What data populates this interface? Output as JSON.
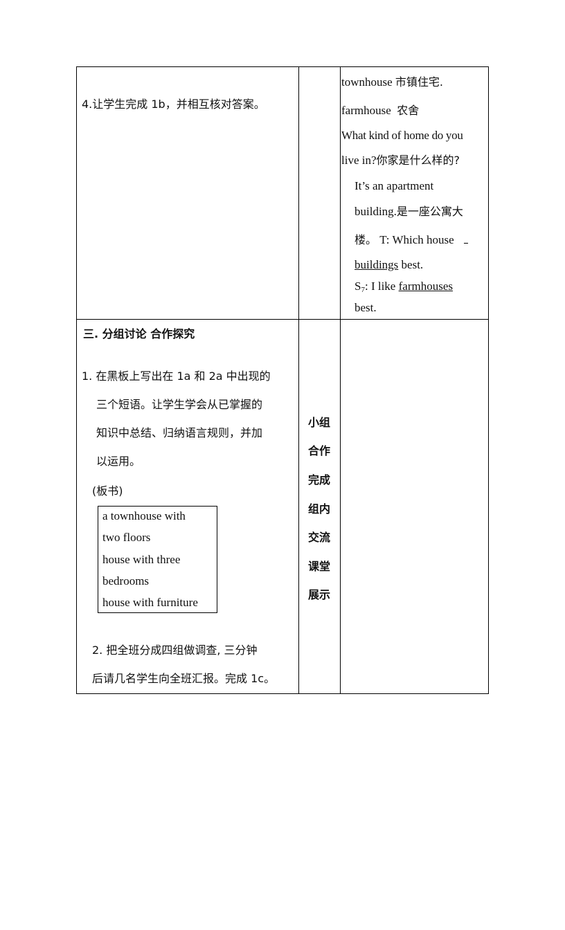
{
  "table": {
    "row1": {
      "left": "4.让学生完成 1b，并相互核对答案。",
      "middle": "",
      "right": {
        "line1_en": "townhouse",
        "line1_cn": "市镇住宅.",
        "line2_en": "farmhouse",
        "line2_cn": "农舍",
        "line3": "What kind of home do you",
        "line4_en": "live in?",
        "line4_cn": "你家是什么样的?",
        "line5": "It’s an apartment",
        "line6_en": "building.",
        "line6_cn": "是一座公寓大",
        "line7_cn": "楼。",
        "line7_en": "T:   Which house",
        "line8_u": "buildings",
        "line8_rest": " best.",
        "line9_s": "S",
        "line9_sub": "7",
        "line9_mid": ": I like ",
        "line9_u": "farmhouses",
        "line10": "best."
      }
    },
    "row2": {
      "heading": "三. 分组讨论  合作探究",
      "item1": [
        "1. 在黑板上写出在 1a 和 2a 中出现的",
        "三个短语。让学生学会从已掌握的",
        "知识中总结、归纳语言规则，并加",
        "以运用。"
      ],
      "board_label": "(板书)",
      "board_lines": [
        "a townhouse with",
        "two floors",
        "house with three",
        "bedrooms",
        "house with furniture"
      ],
      "item2": [
        "2. 把全班分成四组做调查, 三分钟",
        "后请几名学生向全班汇报。完成 1c。"
      ],
      "middle_vertical": [
        "小组",
        "合作",
        "完成",
        "组内",
        "交流",
        "课堂",
        "展示"
      ],
      "right": ""
    }
  }
}
